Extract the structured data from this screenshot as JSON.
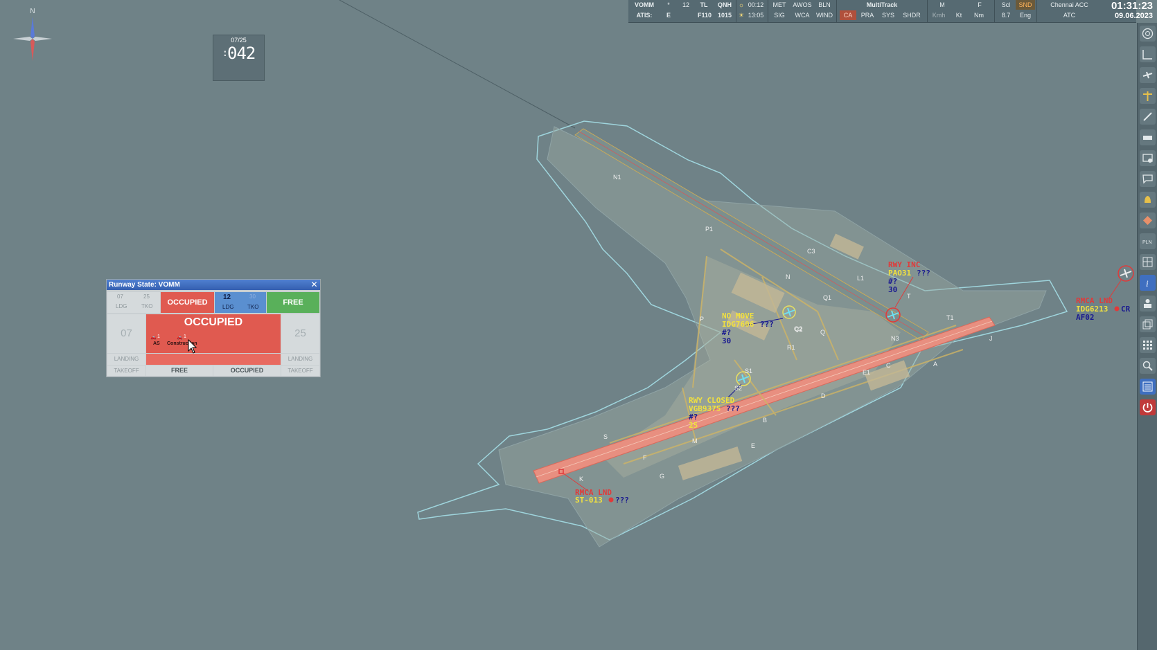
{
  "topbar": {
    "airport": "VOMM",
    "atis_label": "ATIS:",
    "star": "*",
    "atis_letter": "E",
    "wind_dir": "12",
    "tl_label": "TL",
    "tl_value": "F110",
    "qnh_label": "QNH",
    "qnh_value": "1015",
    "sunrise": "00:12",
    "sunset": "13:05",
    "buttons_row1": [
      "MET",
      "AWOS",
      "BLN"
    ],
    "buttons_row2": [
      "SIG",
      "WCA",
      "WIND"
    ],
    "multitrack": "MultiTrack",
    "multitrack_row2": [
      "CA",
      "PRA",
      "SYS",
      "SHDR"
    ],
    "units_row1": [
      "M",
      "F"
    ],
    "units_row2": [
      "Kmh",
      "Kt",
      "Nm"
    ],
    "scl_label": "Scl",
    "scl_value": "8.7",
    "snd": "SND",
    "eng": "Eng",
    "sector": "Chennai ACC",
    "role": "ATC",
    "time": "01:31:23",
    "date": "09.06.2023"
  },
  "compass": {
    "north": "N"
  },
  "runway_counter": {
    "name": "07/25",
    "value": "042",
    "prefix": ":"
  },
  "runway_state": {
    "title": "Runway State: VOMM",
    "close": "✕",
    "rwy1": {
      "a": "07",
      "b": "25",
      "ldg": "LDG",
      "tko": "TKO",
      "status": "OCCUPIED"
    },
    "rwy2": {
      "a": "12",
      "b": "30",
      "ldg": "LDG",
      "tko": "TKO",
      "status": "FREE"
    },
    "left_end": "07",
    "right_end": "25",
    "big_status": "OCCUPIED",
    "veh1": {
      "count": "1",
      "label": "AS"
    },
    "veh2": {
      "count": "1",
      "label": "Construction"
    },
    "landing": "LANDING",
    "takeoff": "TAKEOFF",
    "bottom_left": "FREE",
    "bottom_right": "OCCUPIED",
    "colors": {
      "occupied": "#e05a50",
      "free": "#59b05a",
      "active": "#5a8fd0"
    }
  },
  "aircraft": [
    {
      "alert": "NO MOVE",
      "callsign": "IDG7606",
      "extra": "???",
      "l3": "#?",
      "l4": "30"
    },
    {
      "alert": "RWY INC",
      "callsign": "PAO31",
      "extra": "???",
      "l3": "#?",
      "l4": "30"
    },
    {
      "alert": "RWY CLOSED",
      "callsign": "VGB9375",
      "extra": "???",
      "l3": "#?",
      "l4": "25"
    },
    {
      "alert": "RMCA LND",
      "callsign": "ST-013",
      "extra": "???"
    },
    {
      "alert": "RMCA LND",
      "callsign": "IDG6213",
      "extra": "CR",
      "l3": "AF02"
    }
  ],
  "taxiway_labels": [
    "N1",
    "P1",
    "C3",
    "N",
    "L1",
    "Q1",
    "P",
    "Q2",
    "R1",
    "Q",
    "N3",
    "T",
    "T1",
    "J",
    "S",
    "E1",
    "C",
    "A",
    "D",
    "B",
    "M",
    "E",
    "F",
    "G",
    "K",
    "S1",
    "S2",
    "C2"
  ]
}
